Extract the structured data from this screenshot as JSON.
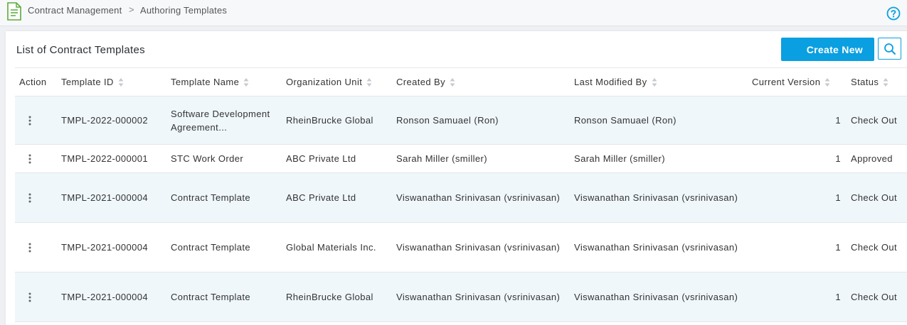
{
  "breadcrumb": {
    "items": [
      "Contract Management",
      "Authoring Templates"
    ],
    "separator": ">"
  },
  "icons": {
    "app": "document-list-icon",
    "help": "help-icon",
    "search": "search-icon",
    "sort": "sort-icon",
    "row_menu": "kebab-menu-icon"
  },
  "colors": {
    "accent": "#0a9fe0",
    "app_icon": "#5aaa3a",
    "row_alt": "#eff7fb"
  },
  "panel": {
    "title": "List of Contract Templates",
    "create_label": "Create New"
  },
  "table": {
    "columns": [
      "Action",
      "Template ID",
      "Template Name",
      "Organization Unit",
      "Created By",
      "Last Modified By",
      "Current Version",
      "Status"
    ],
    "rows": [
      {
        "id": "TMPL-2022-000002",
        "name": "Software Development Agreement...",
        "org": "RheinBrucke Global",
        "created_by": "Ronson Samuael (Ron)",
        "modified_by": "Ronson Samuael (Ron)",
        "version": "1",
        "status": "Check Out"
      },
      {
        "id": "TMPL-2022-000001",
        "name": "STC Work Order",
        "org": "ABC Private Ltd",
        "created_by": "Sarah Miller (smiller)",
        "modified_by": "Sarah Miller (smiller)",
        "version": "1",
        "status": "Approved"
      },
      {
        "id": "TMPL-2021-000004",
        "name": "Contract Template",
        "org": "ABC Private Ltd",
        "created_by": "Viswanathan Srinivasan (vsrinivasan)",
        "modified_by": "Viswanathan Srinivasan (vsrinivasan)",
        "version": "1",
        "status": "Check Out"
      },
      {
        "id": "TMPL-2021-000004",
        "name": "Contract Template",
        "org": "Global Materials Inc.",
        "created_by": "Viswanathan Srinivasan (vsrinivasan)",
        "modified_by": "Viswanathan Srinivasan (vsrinivasan)",
        "version": "1",
        "status": "Check Out"
      },
      {
        "id": "TMPL-2021-000004",
        "name": "Contract Template",
        "org": "RheinBrucke Global",
        "created_by": "Viswanathan Srinivasan (vsrinivasan)",
        "modified_by": "Viswanathan Srinivasan (vsrinivasan)",
        "version": "1",
        "status": "Check Out"
      }
    ]
  }
}
